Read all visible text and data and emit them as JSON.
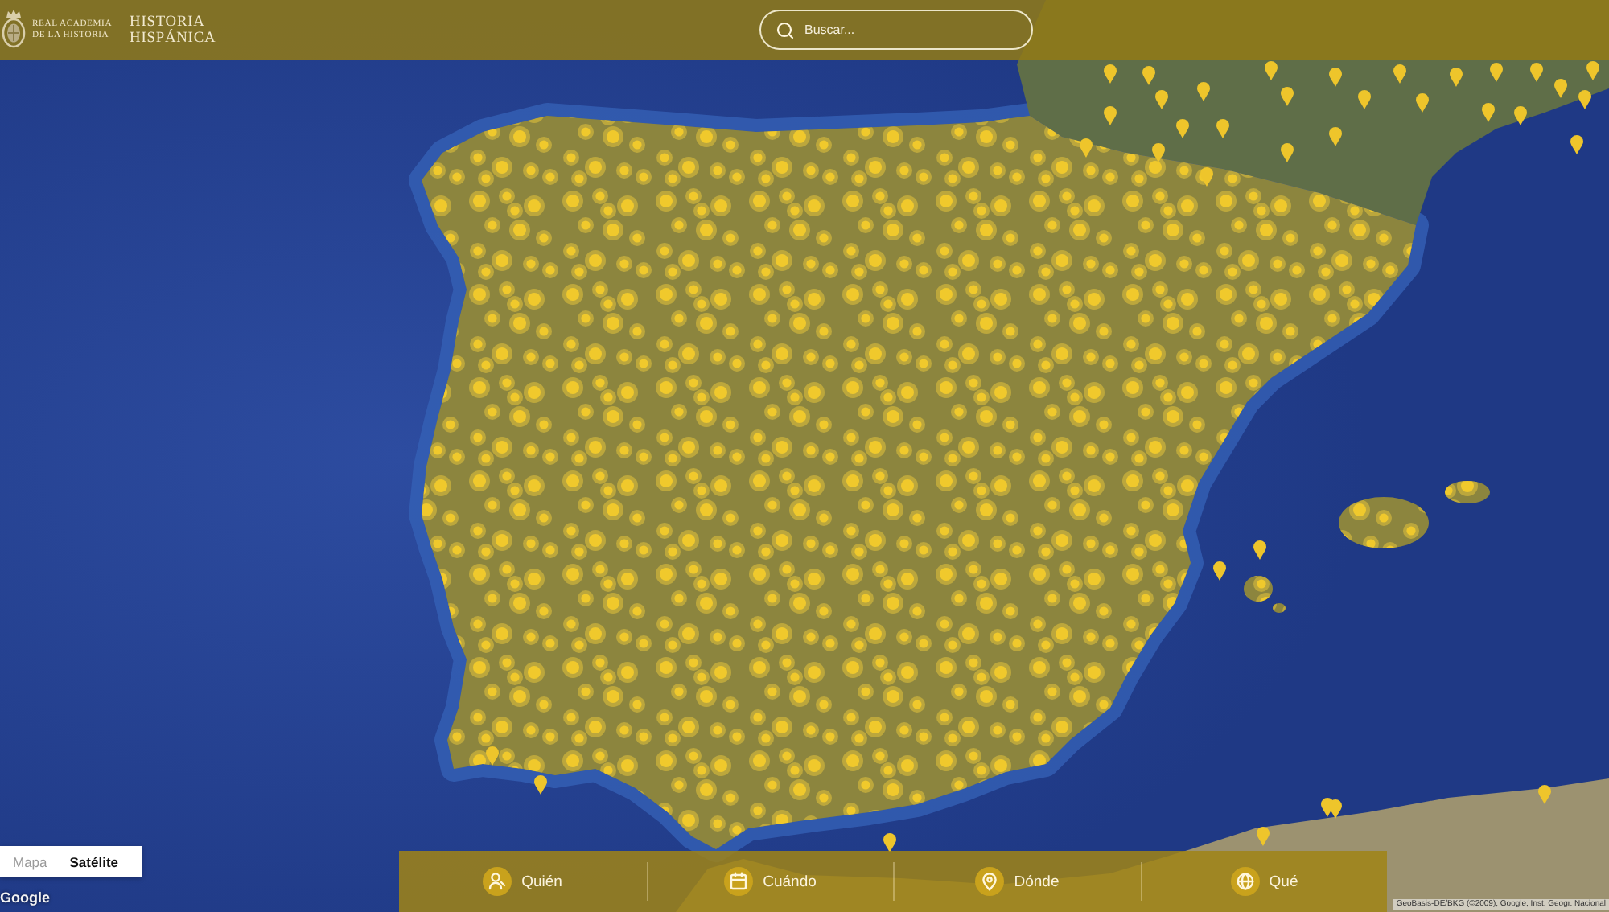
{
  "header": {
    "institution_name": [
      "REAL ACADEMIA",
      "DE LA HISTORIA"
    ],
    "site_title": [
      "HISTORIA",
      "HISPÁNICA"
    ],
    "search": {
      "placeholder": "Buscar..."
    }
  },
  "map": {
    "map_type": [
      {
        "label": "Mapa",
        "selected": false
      },
      {
        "label": "Satélite",
        "selected": true
      }
    ],
    "provider_logo": "Google",
    "attribution": "GeoBasis-DE/BKG (©2009), Google, Inst. Geogr. Nacional"
  },
  "bottom_nav": [
    {
      "label": "Quién",
      "kind": "person"
    },
    {
      "label": "Cuándo",
      "kind": "calendar"
    },
    {
      "label": "Dónde",
      "kind": "place"
    },
    {
      "label": "Qué",
      "kind": "globe"
    }
  ]
}
